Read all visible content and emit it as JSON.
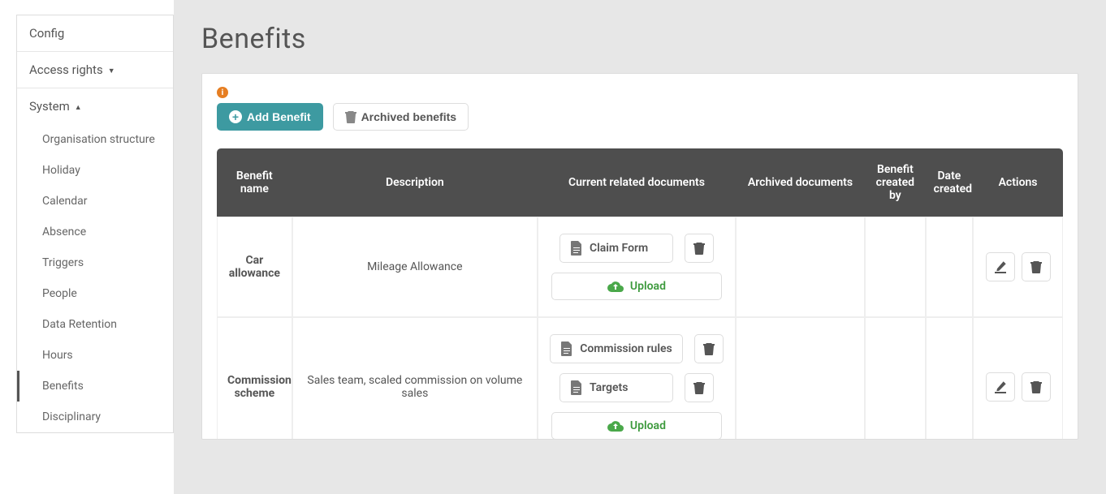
{
  "sidebar": {
    "config": "Config",
    "access_rights": "Access rights",
    "system": "System",
    "items": [
      "Organisation structure",
      "Holiday",
      "Calendar",
      "Absence",
      "Triggers",
      "People",
      "Data Retention",
      "Hours",
      "Benefits",
      "Disciplinary"
    ],
    "active_index": 8
  },
  "page": {
    "title": "Benefits"
  },
  "toolbar": {
    "add_label": "Add Benefit",
    "archived_label": "Archived benefits"
  },
  "table": {
    "headers": {
      "name": "Benefit name",
      "description": "Description",
      "current_docs": "Current related documents",
      "archived_docs": "Archived documents",
      "created_by": "Benefit created by",
      "date_created": "Date created",
      "actions": "Actions"
    },
    "rows": [
      {
        "name": "Car allowance",
        "description": "Mileage Allowance",
        "documents": [
          "Claim Form"
        ],
        "upload_label": "Upload",
        "archived_documents": "",
        "created_by": "",
        "date_created": ""
      },
      {
        "name": "Commission scheme",
        "description": "Sales team, scaled commission on volume sales",
        "documents": [
          "Commission rules",
          "Targets"
        ],
        "upload_label": "Upload",
        "archived_documents": "",
        "created_by": "",
        "date_created": ""
      }
    ]
  },
  "icons": {
    "info": "i",
    "plus": "+"
  }
}
